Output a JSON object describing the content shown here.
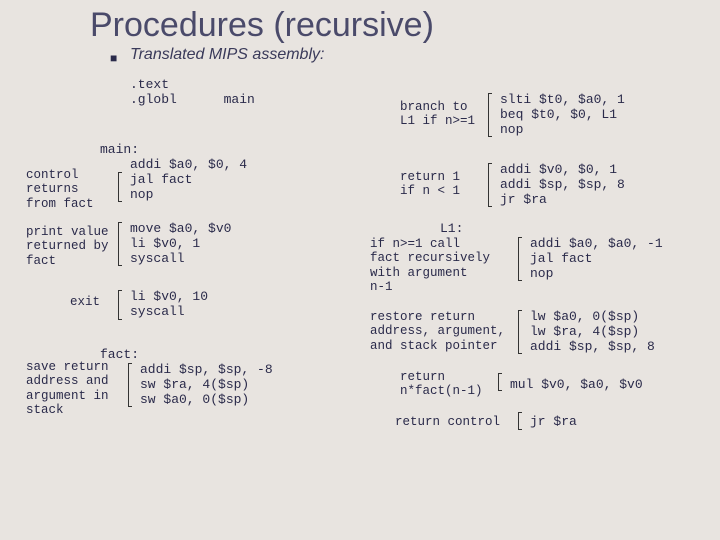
{
  "title": "Procedures (recursive)",
  "subtitle": "Translated MIPS assembly:",
  "code": {
    "text": ".text",
    "globl": ".globl      main",
    "main_label": "main:",
    "addi_a0": "addi $a0, $0, 4",
    "jal_fact": "jal fact",
    "nop1": "nop",
    "move": "move $a0, $v0",
    "li_v0_1": "li $v0, 1",
    "syscall1": "syscall",
    "li_v0_10": "li $v0, 10",
    "syscall2": "syscall",
    "fact_label": "fact:",
    "addi_sp": "addi $sp, $sp, -8",
    "sw_ra": "sw $ra, 4($sp)",
    "sw_a0": "sw $a0, 0($sp)",
    "slti": "slti $t0, $a0, 1",
    "beq": "beq $t0, $0, L1",
    "nop2": "nop",
    "addi_v0": "addi $v0, $0, 1",
    "addi_sp8": "addi $sp, $sp, 8",
    "jr_ra1": "jr $ra",
    "l1_label": "L1:",
    "addi_a0_m1": "addi $a0, $a0, -1",
    "jal_fact2": "jal fact",
    "nop3": "nop",
    "lw_a0": "lw $a0, 0($sp)",
    "lw_ra": "lw $ra, 4($sp)",
    "addi_sp8b": "addi $sp, $sp, 8",
    "mul": "mul $v0, $a0, $v0",
    "jr_ra2": "jr $ra"
  },
  "annot": {
    "control": "control\nreturns\nfrom fact",
    "print": "print value\nreturned by\nfact",
    "exit": "exit",
    "save": "save return\naddress and\nargument in\nstack",
    "branch": "branch to\nL1 if n>=1",
    "return1": "return 1\nif n < 1",
    "ifn": "if n>=1 call\nfact recursively\nwith argument\nn-1",
    "restore": "restore return\naddress, argument,\nand stack pointer",
    "retn": "return\nn*fact(n-1)",
    "retctl": "return control"
  }
}
